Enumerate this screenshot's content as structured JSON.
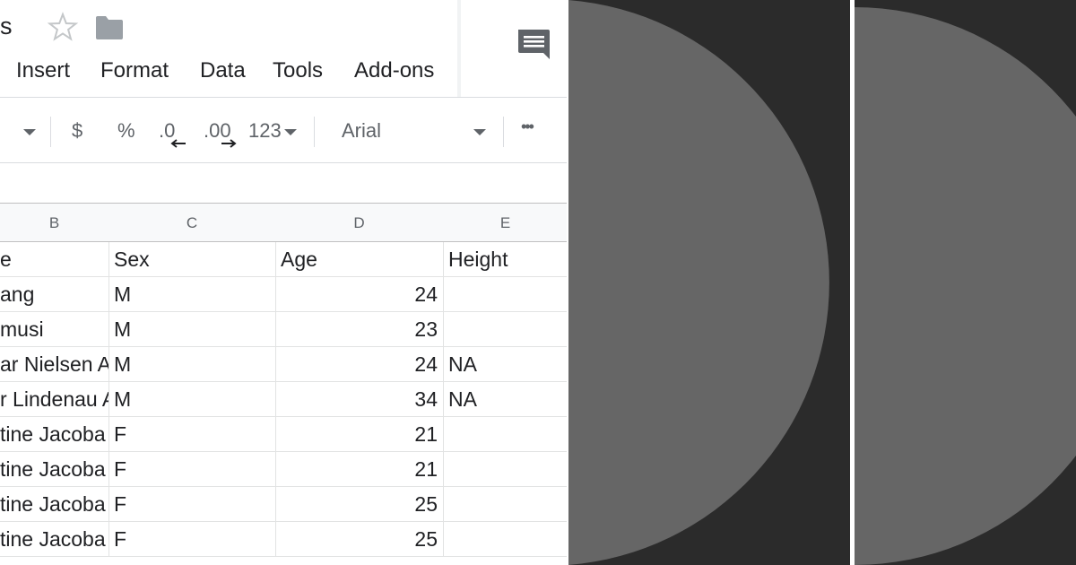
{
  "spreadsheet": {
    "title_fragment": "s",
    "menu": [
      "Insert",
      "Format",
      "Data",
      "Tools",
      "Add-ons"
    ],
    "toolbar": {
      "currency_label": "$",
      "percent_label": "%",
      "decrease_decimal_label": ".0",
      "increase_decimal_label": ".00",
      "number_format_label": "123",
      "font_name": "Arial",
      "more_label": "•••"
    },
    "columns": [
      "B",
      "C",
      "D",
      "E"
    ],
    "header_row": {
      "b": "e",
      "c": "Sex",
      "d": "Age",
      "e": "Height"
    },
    "rows": [
      {
        "b": "ang",
        "c": "M",
        "d": "24",
        "e": ""
      },
      {
        "b": "musi",
        "c": "M",
        "d": "23",
        "e": ""
      },
      {
        "b": "ar Nielsen A",
        "c": "M",
        "d": "24",
        "e": "NA"
      },
      {
        "b": "r Lindenau A",
        "c": "M",
        "d": "34",
        "e": "NA"
      },
      {
        "b": "tine Jacoba",
        "c": "F",
        "d": "21",
        "e": ""
      },
      {
        "b": "tine Jacoba",
        "c": "F",
        "d": "21",
        "e": ""
      },
      {
        "b": "tine Jacoba",
        "c": "F",
        "d": "25",
        "e": ""
      },
      {
        "b": "tine Jacoba",
        "c": "F",
        "d": "25",
        "e": ""
      }
    ]
  },
  "colors": {
    "panel_background": "#2b2b2b",
    "shape_fill": "#666666",
    "icon_gray": "#5f6368",
    "star_outline": "#c4c7c9",
    "grid_line": "#e2e3e3"
  },
  "icons": {
    "star": "star-icon",
    "folder": "folder-icon",
    "comment": "comment-icon"
  }
}
